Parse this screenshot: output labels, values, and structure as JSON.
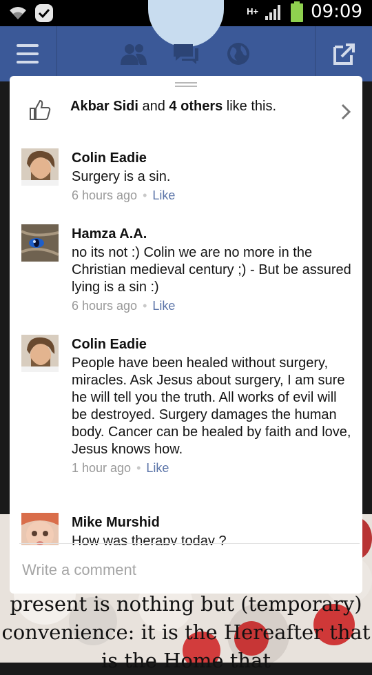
{
  "status_bar": {
    "time": "09:09",
    "network": "H+",
    "icons": [
      "wifi-icon",
      "notification-icon",
      "signal-icon",
      "battery-icon"
    ]
  },
  "navbar": {
    "icons": [
      "menu-icon",
      "friend-requests-icon",
      "messages-icon",
      "notifications-globe-icon",
      "share-icon"
    ],
    "color": "#3b5998"
  },
  "likes": {
    "name": "Akbar Sidi",
    "connector": "and",
    "others": "4 others",
    "suffix": "like this."
  },
  "comments": [
    {
      "author": "Colin Eadie",
      "text": "Surgery is a sin.",
      "time": "6 hours ago",
      "like": "Like"
    },
    {
      "author": "Hamza A.A.",
      "text": "no its not :)  Colin we are no more in the Christian medieval century ;) - But be assured lying is a sin  :)",
      "time": "6 hours ago",
      "like": "Like"
    },
    {
      "author": "Colin Eadie",
      "text": "People have been healed without surgery, miracles. Ask Jesus about surgery, I am sure he will tell you the truth. All works of evil will be destroyed. Surgery damages the human body. Cancer can be healed by faith and love, Jesus knows how.",
      "time": "1 hour ago",
      "like": "Like"
    },
    {
      "author": "Mike Murshid",
      "text": "How was therapy today ?",
      "time": "",
      "like": ""
    }
  ],
  "composer": {
    "placeholder": "Write a comment"
  },
  "background_post": {
    "quote": "present is nothing but (temporary) convenience: it is the Hereafter that is the Home that"
  },
  "colors": {
    "like_link": "#5b74a8",
    "meta": "#999999"
  }
}
